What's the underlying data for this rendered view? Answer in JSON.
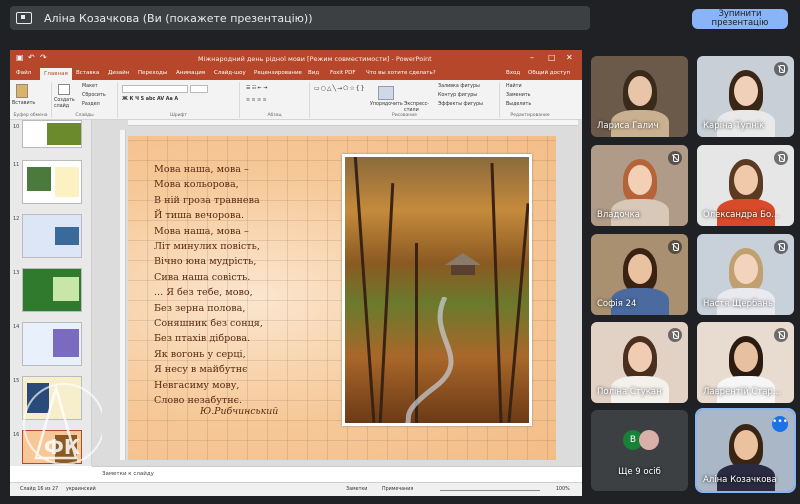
{
  "meet": {
    "presenting_text": "Аліна Козачкова (Ви (покажете презентацію))",
    "stop_button": "Зупинити презентацію"
  },
  "ppt": {
    "window_title": "Міжнародний день рідної мови [Режим совместимости] - PowerPoint",
    "tabs": [
      "Файл",
      "Главная",
      "Вставка",
      "Дизайн",
      "Переходы",
      "Анимация",
      "Слайд-шоу",
      "Рецензирование",
      "Вид",
      "Foxit PDF"
    ],
    "tell_me": "Что вы хотите сделать?",
    "login": "Вход",
    "share": "Общий доступ",
    "groups": {
      "clipboard": "Буфер обмена",
      "slides": "Слайды",
      "font": "Шрифт",
      "paragraph": "Абзац",
      "drawing": "Рисование",
      "editing": "Редактирование"
    },
    "buttons": {
      "paste": "Вставить",
      "create_slide": "Создать слайд",
      "layout": "Макет",
      "reset": "Сбросить",
      "section": "Раздел",
      "arrange": "Упорядочить",
      "express": "Экспресс-стили",
      "fill": "Заливка фигуры",
      "outline": "Контур фигуры",
      "effects": "Эффекты фигуры",
      "find": "Найти",
      "replace": "Заменить",
      "select": "Выделить"
    },
    "slide_numbers": [
      "10",
      "11",
      "12",
      "13",
      "14",
      "15",
      "16"
    ],
    "notes": "Заметки к слайду",
    "status": {
      "slide": "Слайд 16 из 27",
      "lang": "украинский",
      "notes": "Заметки",
      "comments": "Примечания",
      "zoom": "100%"
    }
  },
  "poem": {
    "lines": [
      "Мова наша, мова –",
      "Мова кольорова,",
      "В ній гроза травнева",
      "Й тиша вечорова.",
      "Мова наша, мова –",
      "Літ минулих повість,",
      "Вічно юна мудрість,",
      "Сива наша совість.",
      "... Я без тебе, мово,",
      "Без зерна полова,",
      "Соняшник без сонця,",
      "Без птахів діброва.",
      "Як вогонь у серці,",
      "Я несу в майбутнє",
      "Невгасиму мову,",
      "Слово незабутнє."
    ],
    "author": "Ю.Рибчинський"
  },
  "participants": [
    {
      "name": "Лариса Галич",
      "muted": false
    },
    {
      "name": "Каріна Тупнік",
      "muted": true
    },
    {
      "name": "Владочка",
      "muted": true
    },
    {
      "name": "Олександра Бо...",
      "muted": true
    },
    {
      "name": "Софія 24",
      "muted": true
    },
    {
      "name": "Настя Щербань",
      "muted": true
    },
    {
      "name": "Поліна Стукан",
      "muted": true
    },
    {
      "name": "Лаврентій Стар...",
      "muted": true
    },
    {
      "name": "Ще 9 осіб",
      "muted": false
    },
    {
      "name": "Аліна Козачкова",
      "muted": false
    }
  ],
  "more_avatar": "В",
  "colors": {
    "accent": "#8ab4f8",
    "ppt": "#b7472a"
  }
}
